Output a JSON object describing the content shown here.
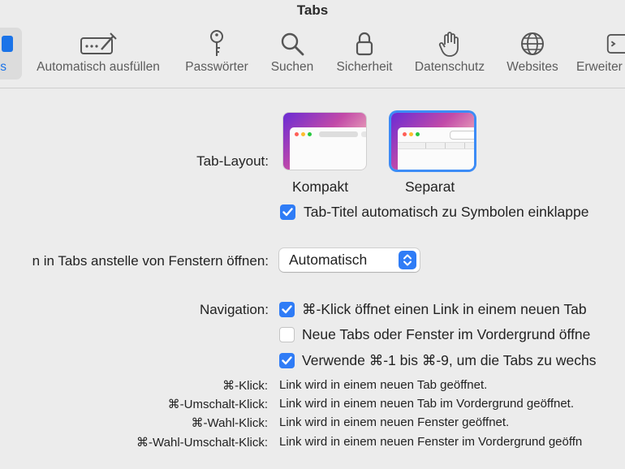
{
  "window": {
    "title": "Tabs"
  },
  "toolbar": {
    "items": [
      {
        "label": "s",
        "icon": "tabs-icon",
        "active": true
      },
      {
        "label": "Automatisch ausfüllen",
        "icon": "autofill-icon"
      },
      {
        "label": "Passwörter",
        "icon": "key-icon"
      },
      {
        "label": "Suchen",
        "icon": "search-icon"
      },
      {
        "label": "Sicherheit",
        "icon": "lock-icon"
      },
      {
        "label": "Datenschutz",
        "icon": "hand-icon"
      },
      {
        "label": "Websites",
        "icon": "globe-icon"
      },
      {
        "label": "Erweiter",
        "icon": "advanced-icon"
      }
    ]
  },
  "tab_layout": {
    "label": "Tab-Layout:",
    "options": [
      {
        "name": "Kompakt",
        "selected": false
      },
      {
        "name": "Separat",
        "selected": true
      }
    ],
    "collapse_checkbox": {
      "label": "Tab-Titel automatisch zu Symbolen einklappe",
      "checked": true
    }
  },
  "open_pages": {
    "label": "n in Tabs anstelle von Fenstern öffnen:",
    "value": "Automatisch"
  },
  "navigation": {
    "label": "Navigation:",
    "options": [
      {
        "label": "⌘-Klick öffnet einen Link in einem neuen Tab",
        "checked": true
      },
      {
        "label": "Neue Tabs oder Fenster im Vordergrund öffne",
        "checked": false
      },
      {
        "label": "Verwende ⌘-1 bis ⌘-9, um die Tabs zu wechs",
        "checked": true
      }
    ]
  },
  "shortcuts": [
    {
      "keys": "⌘-Klick:",
      "desc": "Link wird in einem neuen Tab geöffnet."
    },
    {
      "keys": "⌘-Umschalt-Klick:",
      "desc": "Link wird in einem neuen Tab im Vordergrund geöffnet."
    },
    {
      "keys": "⌘-Wahl-Klick:",
      "desc": "Link wird in einem neuen Fenster geöffnet."
    },
    {
      "keys": "⌘-Wahl-Umschalt-Klick:",
      "desc": "Link wird in einem neuen Fenster im Vordergrund geöffn"
    }
  ],
  "colors": {
    "accent": "#2f7cf6",
    "background": "#ececec"
  }
}
